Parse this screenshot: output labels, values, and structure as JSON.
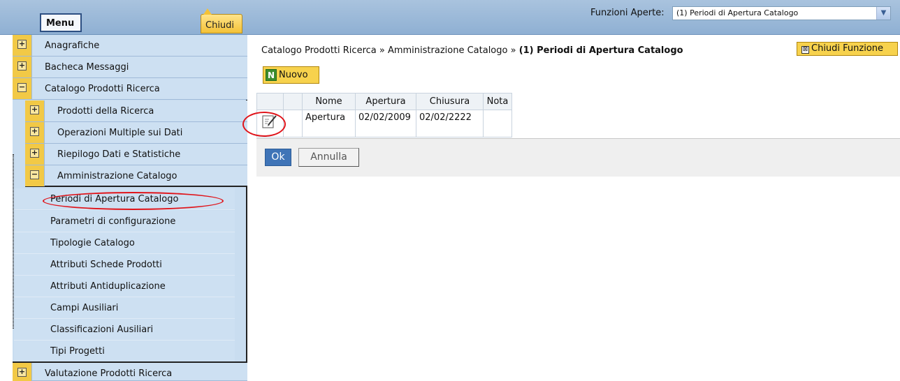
{
  "topbar": {
    "menu_label": "Menu",
    "close_menu_label": "Chiudi",
    "open_functions_label": "Funzioni Aperte:",
    "open_functions_value": "(1) Periodi di Apertura Catalogo"
  },
  "sidebar": {
    "items": [
      {
        "label": "Anagrafiche",
        "toggle": "+"
      },
      {
        "label": "Bacheca Messaggi",
        "toggle": "+"
      },
      {
        "label": "Catalogo Prodotti Ricerca",
        "toggle": "−"
      },
      {
        "label": "Prodotti della Ricerca",
        "toggle": "+"
      },
      {
        "label": "Operazioni Multiple sui Dati",
        "toggle": "+"
      },
      {
        "label": "Riepilogo Dati e Statistiche",
        "toggle": "+"
      },
      {
        "label": "Amministrazione Catalogo",
        "toggle": "−"
      },
      {
        "label": "Valutazione Prodotti Ricerca",
        "toggle": "+"
      }
    ],
    "leaves": [
      "Periodi di Apertura Catalogo",
      "Parametri di configurazione",
      "Tipologie Catalogo",
      "Attributi Schede Prodotti",
      "Attributi Antiduplicazione",
      "Campi Ausiliari",
      "Classificazioni Ausiliari",
      "Tipi Progetti"
    ]
  },
  "main": {
    "breadcrumb_path": "Catalogo Prodotti Ricerca » Amministrazione Catalogo » ",
    "breadcrumb_current": "(1) Periodi di Apertura Catalogo",
    "close_function_label": "Chiudi Funzione",
    "close_function_icon": "⊠",
    "new_label": "Nuovo",
    "new_icon": "N",
    "table": {
      "headers": [
        "Nome",
        "Apertura",
        "Chiusura",
        "Nota"
      ],
      "rows": [
        {
          "nome": "Apertura",
          "apertura": "02/02/2009",
          "chiusura": "02/02/2222",
          "nota": ""
        }
      ]
    },
    "ok_label": "Ok",
    "cancel_label": "Annulla"
  },
  "colors": {
    "accent_yellow": "#f7d24d",
    "menu_blue": "#cde0f2",
    "ok_blue": "#3f74b7",
    "highlight_red": "#e0141a"
  }
}
